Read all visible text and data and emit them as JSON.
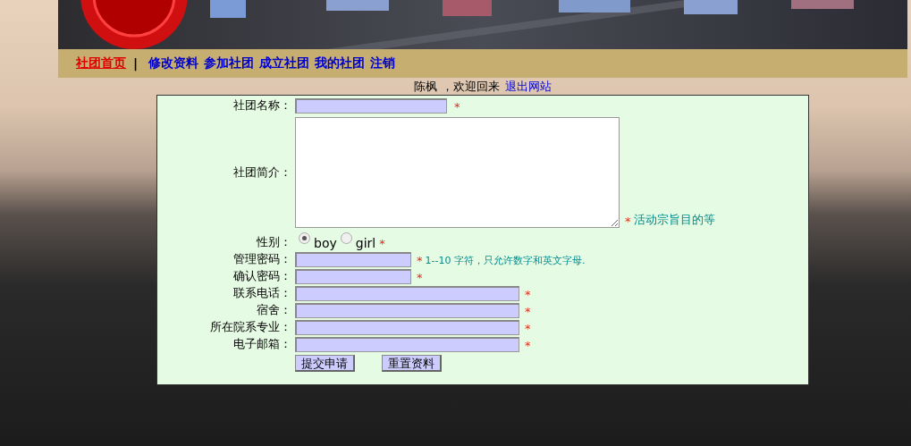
{
  "nav": {
    "items": [
      {
        "label": "社团首页",
        "selected": true
      },
      {
        "label": "修改资料",
        "selected": false
      },
      {
        "label": "参加社团",
        "selected": false
      },
      {
        "label": "成立社团",
        "selected": false
      },
      {
        "label": "我的社团",
        "selected": false
      },
      {
        "label": "注销",
        "selected": false
      }
    ],
    "separator": "|"
  },
  "welcome": {
    "text": "陈枫 ，欢迎回来",
    "link": "退出网站"
  },
  "form": {
    "fields": [
      {
        "kind": "short_input",
        "label": "社团名称：",
        "mark": "*"
      },
      {
        "kind": "textarea",
        "label": "社团简介：",
        "mark": "*",
        "hint": "活动宗旨目的等"
      },
      {
        "kind": "radio",
        "label": "性别：",
        "mark": "*",
        "options": [
          {
            "label": "boy",
            "selected": true
          },
          {
            "label": "girl",
            "selected": false
          }
        ]
      },
      {
        "kind": "password",
        "label": "管理密码：",
        "mark": "*",
        "hint": "1--10 字符，只允许数字和英文字母."
      },
      {
        "kind": "password",
        "label": "确认密码：",
        "mark": "*"
      },
      {
        "kind": "long_input",
        "label": "联系电话：",
        "mark": "*"
      },
      {
        "kind": "long_input",
        "label": "宿舍：",
        "mark": "*"
      },
      {
        "kind": "long_input",
        "label": "所在院系专业：",
        "mark": "*"
      },
      {
        "kind": "long_input",
        "label": "电子邮箱：",
        "mark": "*"
      }
    ],
    "buttons": [
      "提交申请",
      "重置资料"
    ]
  }
}
